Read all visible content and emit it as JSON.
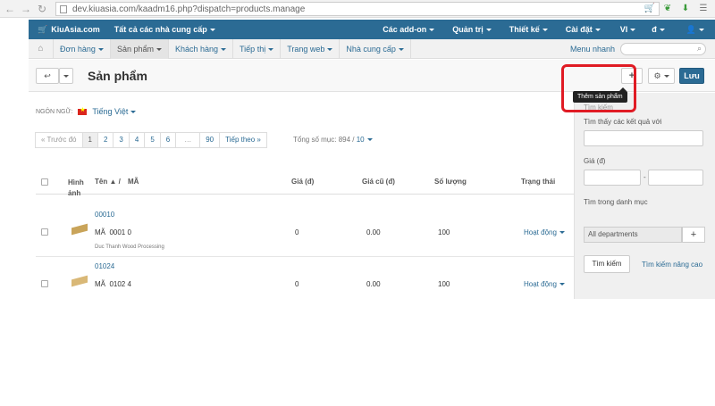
{
  "browser": {
    "url": "dev.kiuasia.com/kaadm16.php?dispatch=products.manage"
  },
  "topbar": {
    "brand": "KiuAsia.com",
    "vendor_select": "Tất cả các nhà cung cấp",
    "addons": "Các add-on",
    "admin": "Quản trị",
    "design": "Thiết kế",
    "settings": "Cài đặt",
    "lang": "VI",
    "currency": "đ",
    "user_icon": "user-icon"
  },
  "menubar": {
    "items": [
      {
        "label": "Đơn hàng"
      },
      {
        "label": "Sản phẩm"
      },
      {
        "label": "Khách hàng"
      },
      {
        "label": "Tiếp thị"
      },
      {
        "label": "Trang web"
      },
      {
        "label": "Nhà cung cấp"
      }
    ],
    "quick_menu": "Menu nhanh"
  },
  "titlebar": {
    "title": "Sản phẩm",
    "add_button": "+",
    "save_button": "Lưu",
    "tooltip": "Thêm sản phẩm"
  },
  "main": {
    "language_label": "NGÔN NGỮ:",
    "language_value": "Tiếng Việt",
    "pager": {
      "prev": "« Trước đó",
      "pages": [
        "1",
        "2",
        "3",
        "4",
        "5",
        "6",
        "…",
        "90"
      ],
      "next": "Tiếp theo »"
    },
    "total_label": "Tổng số mục: 894 /",
    "per_page": "10",
    "headers": {
      "image_line1": "Hình",
      "image_line2": "ảnh",
      "name": "Tên ▲ /",
      "code": "MÃ",
      "price": "Giá (đ)",
      "old_price": "Giá cũ (đ)",
      "quantity": "Số lượng",
      "status": "Trạng thái"
    },
    "rows": [
      {
        "name": "00010",
        "code_label": "MÃ",
        "code": "0001 0",
        "vendor": "Duc Thanh Wood Processing",
        "price": "0",
        "old_price": "0.00",
        "quantity": "100",
        "status": "Hoạt động"
      },
      {
        "name": "01024",
        "code_label": "MÃ",
        "code": "0102 4",
        "vendor": "",
        "price": "0",
        "old_price": "0.00",
        "quantity": "100",
        "status": "Hoạt động"
      }
    ]
  },
  "sidebar": {
    "heading": "Tìm kiếm",
    "find_label": "Tìm thấy các kết quả với",
    "price_label": "Giá (đ)",
    "price_sep": "-",
    "category_label": "Tìm trong danh mục",
    "category_value": "All departments",
    "add_label": "+",
    "search_button": "Tìm kiếm",
    "advanced_link": "Tìm kiếm nâng cao"
  },
  "colors": {
    "topbar": "#2b6b94",
    "highlight": "#e01b24"
  }
}
